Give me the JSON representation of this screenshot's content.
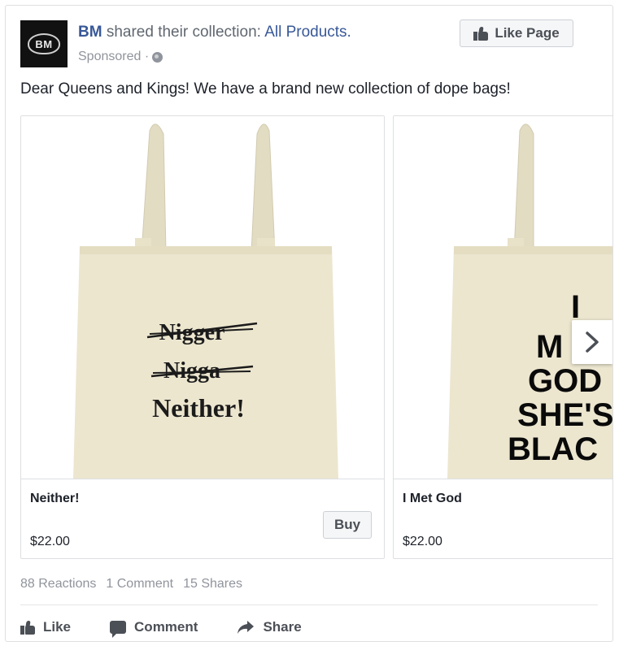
{
  "post": {
    "page_name": "BM",
    "headline_middle": " shared their collection: ",
    "collection_name": "All Products.",
    "sponsored_label": "Sponsored ·",
    "like_page_label": "Like Page",
    "avatar_text": "BM",
    "text": "Dear Queens and Kings! We have a brand new collection of dope bags!"
  },
  "products": [
    {
      "name": "Neither!",
      "price": "$22.00",
      "buy_label": "Buy",
      "print_lines": [
        "Nigger",
        "Nigga",
        "Neither!"
      ]
    },
    {
      "name": "I Met God",
      "price": "$22.00",
      "print_lines": [
        "I",
        "M",
        "GOD",
        "SHE'S",
        "BLAC"
      ]
    }
  ],
  "stats": {
    "reactions": "88 Reactions",
    "comments": "1 Comment",
    "shares": "15 Shares"
  },
  "actions": {
    "like": "Like",
    "comment": "Comment",
    "share": "Share"
  },
  "icons": {
    "thumbs_up": "thumbs-up-icon",
    "globe": "globe-icon",
    "comment": "comment-icon",
    "share": "share-arrow-icon",
    "next": "chevron-right-icon"
  },
  "colors": {
    "link": "#385898",
    "muted": "#90949c",
    "button_bg": "#f5f6f7",
    "tote": "#ece6cf"
  }
}
